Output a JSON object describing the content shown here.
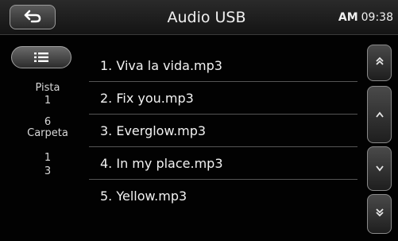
{
  "header": {
    "title": "Audio USB",
    "clock_ampm": "AM",
    "clock_time": "09:38"
  },
  "icons": {
    "back": "back-arrow-icon",
    "menu": "list-menu-icon",
    "scroll_top": "double-chevron-up-icon",
    "scroll_up": "chevron-up-icon",
    "scroll_down": "chevron-down-icon",
    "scroll_bottom": "double-chevron-down-icon"
  },
  "info": {
    "track_label": "Pista",
    "track_current": "1",
    "track_total": "6",
    "folder_label": "Carpeta",
    "folder_current": "1",
    "folder_total": "3"
  },
  "tracks": [
    "1. Viva la vida.mp3",
    "2. Fix you.mp3",
    "3. Everglow.mp3",
    "4. In my place.mp3",
    "5. Yellow.mp3"
  ]
}
